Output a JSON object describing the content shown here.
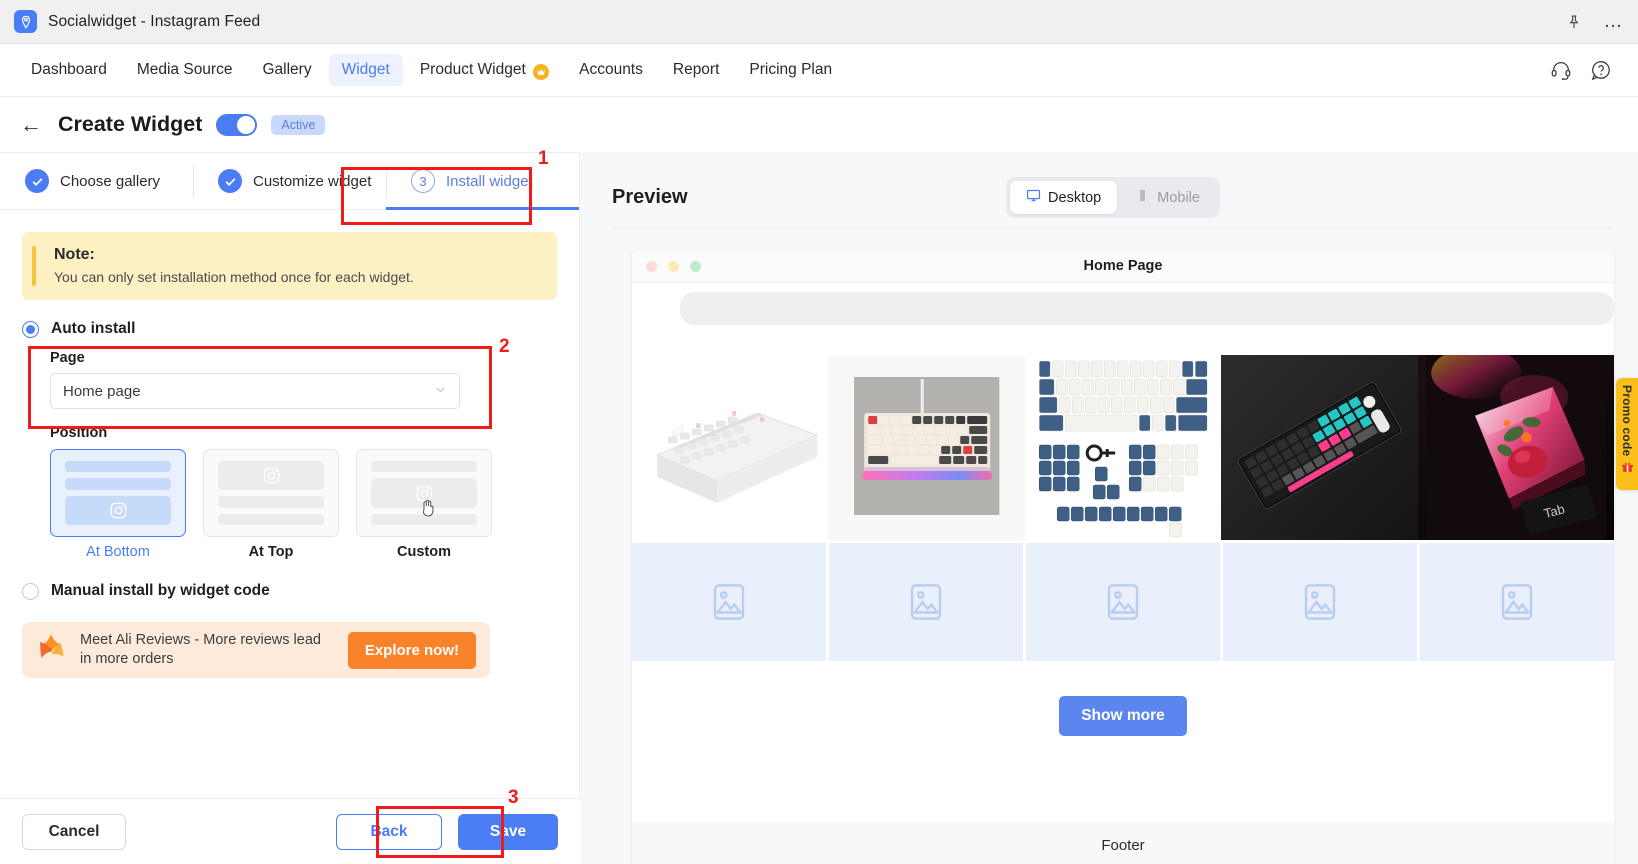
{
  "titlebar": {
    "app_name": "Socialwidget - Instagram Feed",
    "pin_icon": "pin-icon",
    "more_icon": "more-options-icon"
  },
  "nav": {
    "items": [
      {
        "label": "Dashboard",
        "active": false,
        "badge": null
      },
      {
        "label": "Media Source",
        "active": false,
        "badge": null
      },
      {
        "label": "Gallery",
        "active": false,
        "badge": null
      },
      {
        "label": "Widget",
        "active": true,
        "badge": null
      },
      {
        "label": "Product Widget",
        "active": false,
        "badge": "crown-icon"
      },
      {
        "label": "Accounts",
        "active": false,
        "badge": null
      },
      {
        "label": "Report",
        "active": false,
        "badge": null
      },
      {
        "label": "Pricing Plan",
        "active": false,
        "badge": null
      }
    ],
    "support_icon": "headset-icon",
    "help_icon": "question-mark-icon"
  },
  "page_header": {
    "back_label": "←",
    "title": "Create Widget",
    "toggle_on": true,
    "status_label": "Active"
  },
  "steps": [
    {
      "label": "Choose gallery",
      "state": "done",
      "number": "1"
    },
    {
      "label": "Customize widget",
      "state": "done",
      "number": "2"
    },
    {
      "label": "Install widget",
      "state": "current",
      "number": "3"
    }
  ],
  "annotations": [
    {
      "number": "1",
      "target": "install-widget-step"
    },
    {
      "number": "2",
      "target": "page-select-group"
    },
    {
      "number": "3",
      "target": "save-button"
    }
  ],
  "note": {
    "title": "Note:",
    "text": "You can only set installation method once for each widget."
  },
  "install": {
    "auto_label": "Auto install",
    "auto_selected": true,
    "manual_label": "Manual install by widget code",
    "manual_selected": false,
    "page_field_label": "Page",
    "page_value": "Home page",
    "page_options": [
      "Home page"
    ],
    "chevron_icon": "chevron-down-icon",
    "position_label": "Position",
    "positions": [
      {
        "label": "At Bottom",
        "selected": true,
        "layout": "bars-then-widget"
      },
      {
        "label": "At Top",
        "selected": false,
        "layout": "widget-then-bars"
      },
      {
        "label": "Custom",
        "selected": false,
        "layout": "bar-widget-bar"
      }
    ]
  },
  "promo_card": {
    "icon": "ali-reviews-star-icon",
    "text": "Meet Ali Reviews - More reviews lead in more orders",
    "button_label": "Explore now!"
  },
  "footer_buttons": {
    "cancel": "Cancel",
    "back": "Back",
    "save": "Save"
  },
  "preview": {
    "title": "Preview",
    "device_tabs": [
      {
        "label": "Desktop",
        "icon": "monitor-icon",
        "active": true
      },
      {
        "label": "Mobile",
        "icon": "phone-icon",
        "active": false
      }
    ],
    "browser_title": "Home Page",
    "traffic_lights": [
      "#fcdada",
      "#fbeab6",
      "#bdeccd"
    ],
    "gallery_items": [
      {
        "alt": "white keyboard case on white background"
      },
      {
        "alt": "cream and dark mechanical keyboard with RGB underglow"
      },
      {
        "alt": "blue and white keycap set laid out"
      },
      {
        "alt": "black keyboard with teal and pink keycaps"
      },
      {
        "alt": "resin artisan keycap with flowers on dark keyboard"
      }
    ],
    "placeholder_count": 5,
    "placeholder_icon": "image-placeholder-icon",
    "show_more_label": "Show more",
    "footer_label": "Footer"
  },
  "promo_tab": {
    "label": "Promo code",
    "icon": "gift-icon"
  },
  "colors": {
    "accent_blue": "#4a7cf3",
    "nav_active_bg": "#eef2fe",
    "note_yellow": "#fdf0c3",
    "note_bar": "#f5c33b",
    "promo_orange": "#f8832a",
    "promo_card_bg": "#fdeada",
    "annotation_red": "#ef1b1b",
    "promo_tab_yellow": "#fcbf1a",
    "placeholder_blue": "#eaf0fb",
    "show_more_blue": "#5b86ef"
  }
}
